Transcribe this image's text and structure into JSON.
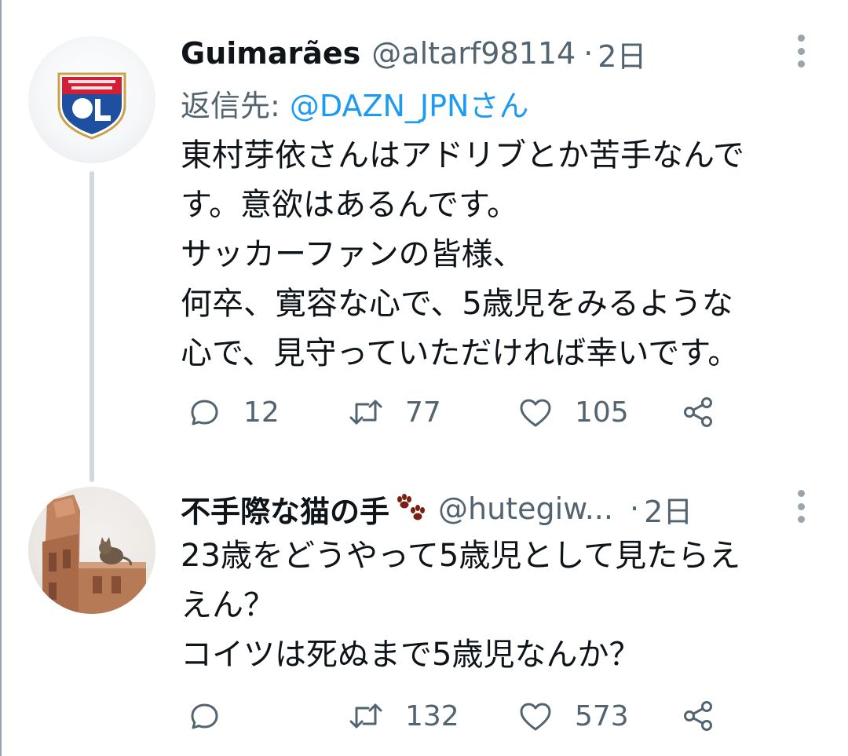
{
  "tweets": [
    {
      "display_name": "Guimarães",
      "handle": "@altarf98114",
      "time_separator": "·",
      "time": "2日",
      "reply_prefix": "返信先: ",
      "reply_mention": "@DAZN_JPNさん",
      "avatar_icon": "olympique-lyonnais-crest-icon",
      "body_lines": [
        "東村芽依さんはアドリブとか苦手なんで",
        "す。意欲はあるんです。",
        "サッカーファンの皆様、",
        "何卒、寛容な心で、5歳児をみるような",
        "心で、見守っていただければ幸いです。"
      ],
      "reply_count": "12",
      "retweet_count": "77",
      "like_count": "105"
    },
    {
      "display_name": "不手際な猫の手",
      "name_emoji_icon": "paw-prints-icon",
      "handle": "@hutegiw...",
      "time_separator": "·",
      "time": "2日",
      "avatar_icon": "cat-on-building-photo",
      "body_lines": [
        "23歳をどうやって5歳児として見たらえ",
        "えん？",
        "コイツは死ぬまで5歳児なんか？"
      ],
      "reply_count": "",
      "retweet_count": "132",
      "like_count": "573"
    }
  ],
  "colors": {
    "text_primary": "#0f1419",
    "text_secondary": "#536471",
    "mention_blue": "#1d9bf0",
    "thread_line": "#cfd9de"
  }
}
